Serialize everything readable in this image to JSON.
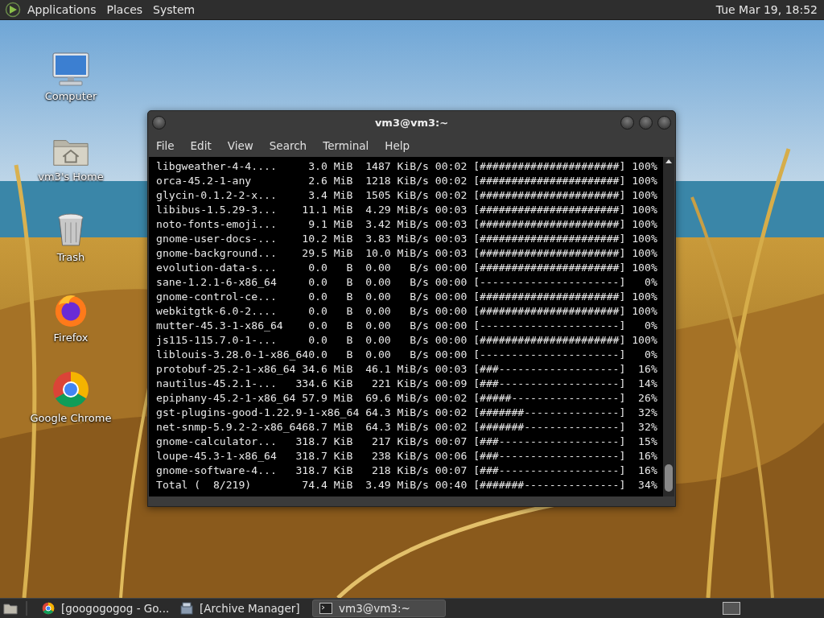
{
  "top_panel": {
    "menus": [
      "Applications",
      "Places",
      "System"
    ],
    "clock": "Tue Mar 19, 18:52"
  },
  "desktop_icons": [
    {
      "kind": "computer",
      "label": "Computer"
    },
    {
      "kind": "home",
      "label": "vm3's Home"
    },
    {
      "kind": "trash",
      "label": "Trash"
    },
    {
      "kind": "firefox",
      "label": "Firefox"
    },
    {
      "kind": "chrome",
      "label": "Google Chrome"
    }
  ],
  "terminal": {
    "title": "vm3@vm3:~",
    "menu": [
      "File",
      "Edit",
      "View",
      "Search",
      "Terminal",
      "Help"
    ],
    "lines": [
      "libgweather-4-4....     3.0 MiB  1487 KiB/s 00:02 [######################] 100%",
      "orca-45.2-1-any         2.6 MiB  1218 KiB/s 00:02 [######################] 100%",
      "glycin-0.1.2-2-x...     3.4 MiB  1505 KiB/s 00:02 [######################] 100%",
      "libibus-1.5.29-3...    11.1 MiB  4.29 MiB/s 00:03 [######################] 100%",
      "noto-fonts-emoji...     9.1 MiB  3.42 MiB/s 00:03 [######################] 100%",
      "gnome-user-docs-...    10.2 MiB  3.83 MiB/s 00:03 [######################] 100%",
      "gnome-background...    29.5 MiB  10.0 MiB/s 00:03 [######################] 100%",
      "evolution-data-s...     0.0   B  0.00   B/s 00:00 [######################] 100%",
      "sane-1.2.1-6-x86_64     0.0   B  0.00   B/s 00:00 [----------------------]   0%",
      "gnome-control-ce...     0.0   B  0.00   B/s 00:00 [######################] 100%",
      "webkitgtk-6.0-2....     0.0   B  0.00   B/s 00:00 [######################] 100%",
      "mutter-45.3-1-x86_64    0.0   B  0.00   B/s 00:00 [----------------------]   0%",
      "js115-115.7.0-1-...     0.0   B  0.00   B/s 00:00 [######################] 100%",
      "liblouis-3.28.0-1-x86_640.0   B  0.00   B/s 00:00 [----------------------]   0%",
      "protobuf-25.2-1-x86_64 34.6 MiB  46.1 MiB/s 00:03 [###-------------------]  16%",
      "nautilus-45.2.1-...   334.6 KiB   221 KiB/s 00:09 [###-------------------]  14%",
      "epiphany-45.2-1-x86_64 57.9 MiB  69.6 MiB/s 00:02 [#####-----------------]  26%",
      "gst-plugins-good-1.22.9-1-x86_64 64.3 MiB/s 00:02 [#######---------------]  32%",
      "net-snmp-5.9.2-2-x86_6468.7 MiB  64.3 MiB/s 00:02 [#######---------------]  32%",
      "gnome-calculator...   318.7 KiB   217 KiB/s 00:07 [###-------------------]  15%",
      "loupe-45.3-1-x86_64   318.7 KiB   238 KiB/s 00:06 [###-------------------]  16%",
      "gnome-software-4...   318.7 KiB   218 KiB/s 00:07 [###-------------------]  16%",
      "Total (  8/219)        74.4 MiB  3.49 MiB/s 00:40 [#######---------------]  34%"
    ]
  },
  "taskbar": {
    "items": [
      {
        "kind": "chrome",
        "label": "[googogogog - Go...",
        "selected": false
      },
      {
        "kind": "archive",
        "label": "[Archive Manager]",
        "selected": false
      },
      {
        "kind": "terminal",
        "label": "vm3@vm3:~",
        "selected": true
      }
    ]
  }
}
